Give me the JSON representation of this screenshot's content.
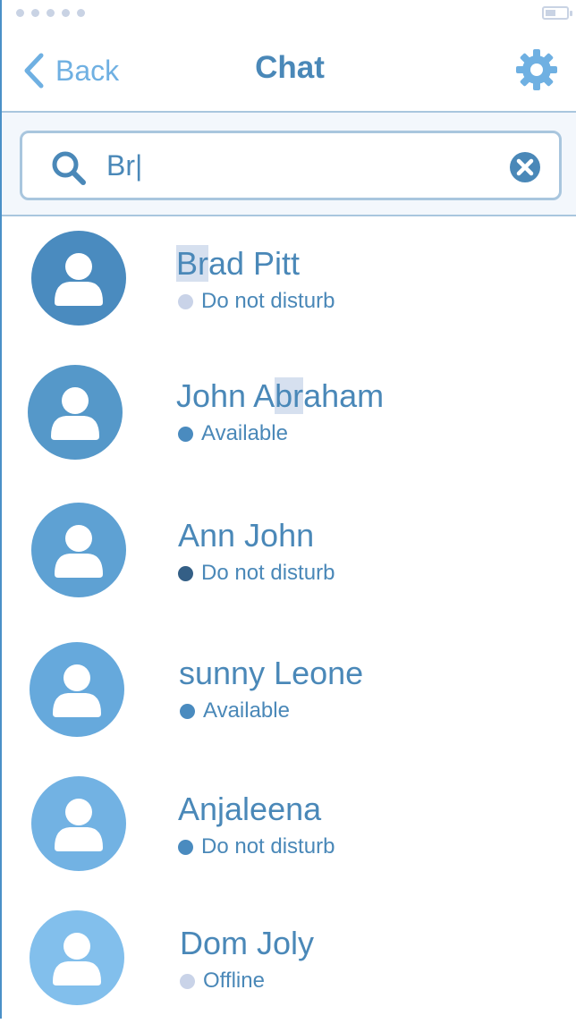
{
  "header": {
    "back_label": "Back",
    "title": "Chat"
  },
  "search": {
    "value": "Br|"
  },
  "contacts": [
    {
      "name_parts": [
        "",
        "Br",
        "ad Pitt"
      ],
      "status": "Do not disturb",
      "status_color": "#c9d3e8",
      "avatar_color": "#4a8bbf"
    },
    {
      "name_parts": [
        "John A",
        "br",
        "aham"
      ],
      "status": "Available",
      "status_color": "#4a8bbf",
      "avatar_color": "#5598c9"
    },
    {
      "name_parts": [
        "Ann John",
        "",
        ""
      ],
      "status": "Do not disturb",
      "status_color": "#345f86",
      "avatar_color": "#5ea1d3"
    },
    {
      "name_parts": [
        "sunny Leone",
        "",
        ""
      ],
      "status": "Available",
      "status_color": "#4a8bbf",
      "avatar_color": "#66a9dc"
    },
    {
      "name_parts": [
        "Anjaleena",
        "",
        ""
      ],
      "status": "Do not disturb",
      "status_color": "#4a8bbf",
      "avatar_color": "#72b2e3"
    },
    {
      "name_parts": [
        "Dom Joly",
        "",
        ""
      ],
      "status": "Offline",
      "status_color": "#c9d3e8",
      "avatar_color": "#82bfec"
    }
  ],
  "colors": {
    "accent": "#4a88b8",
    "back": "#6fb0e2",
    "gear": "#6fb0e2",
    "highlight": "#d6e0ef"
  },
  "icons": {
    "back": "chevron-left-icon",
    "settings": "gear-icon",
    "search": "search-icon",
    "clear": "close-circle-icon",
    "avatar": "user-icon"
  }
}
